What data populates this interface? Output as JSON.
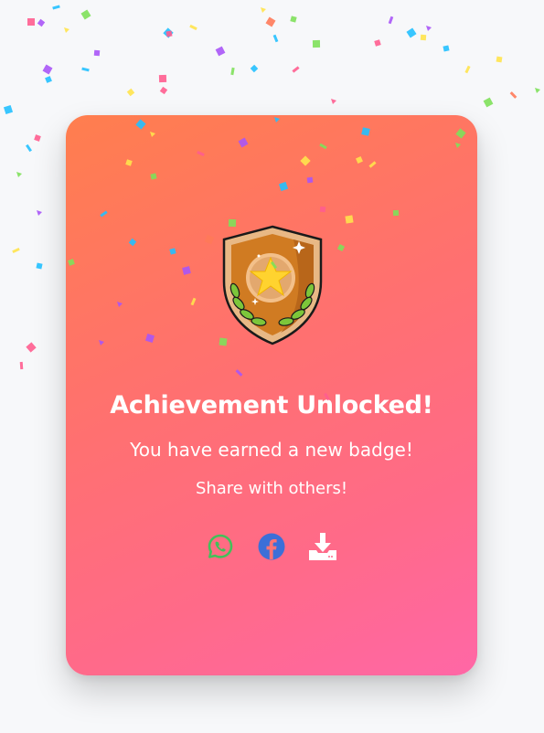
{
  "card": {
    "title": "Achievement Unlocked!",
    "subtitle": "You have earned a new badge!",
    "share_prompt": "Share with others!"
  },
  "badge": {
    "icon": "shield-star-laurel-icon",
    "colors": {
      "shield": "#d07b22",
      "shield_border": "#e8b885",
      "star": "#ffd32f",
      "laurel": "#7cc63a"
    }
  },
  "share_buttons": [
    {
      "icon": "whatsapp-icon",
      "color": "#43c05a"
    },
    {
      "icon": "facebook-icon",
      "color": "#3c6fd8"
    },
    {
      "icon": "download-icon",
      "color": "#ffffff"
    }
  ],
  "theme": {
    "card_gradient_start": "#ff7e4e",
    "card_gradient_end": "#ff67a6",
    "confetti_colors": [
      "#ff5d8f",
      "#a855f7",
      "#22c0ff",
      "#ffe34d",
      "#7ee05a",
      "#ff7a59"
    ]
  }
}
